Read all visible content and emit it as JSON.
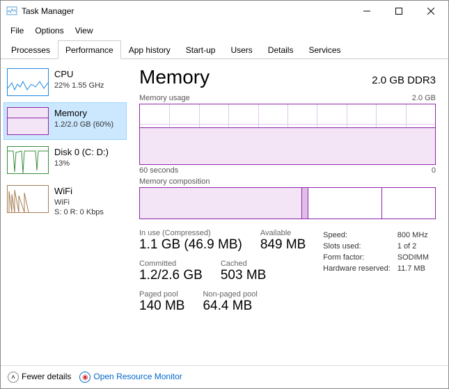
{
  "window": {
    "title": "Task Manager"
  },
  "menu": [
    "File",
    "Options",
    "View"
  ],
  "tabs": [
    "Processes",
    "Performance",
    "App history",
    "Start-up",
    "Users",
    "Details",
    "Services"
  ],
  "active_tab": 1,
  "sidebar": {
    "items": [
      {
        "name": "CPU",
        "sub": "22% 1.55 GHz"
      },
      {
        "name": "Memory",
        "sub": "1.2/2.0 GB (60%)"
      },
      {
        "name": "Disk 0 (C: D:)",
        "sub": "13%"
      },
      {
        "name": "WiFi",
        "sub": "WiFi",
        "sub2": "S: 0 R: 0 Kbps"
      }
    ],
    "selected": 1
  },
  "main": {
    "heading": "Memory",
    "heading_right": "2.0 GB DDR3",
    "usage_label": "Memory usage",
    "usage_max": "2.0 GB",
    "axis_left": "60 seconds",
    "axis_right": "0",
    "composition_label": "Memory composition",
    "stats": {
      "in_use_lbl": "In use (Compressed)",
      "in_use": "1.1 GB (46.9 MB)",
      "available_lbl": "Available",
      "available": "849 MB",
      "committed_lbl": "Committed",
      "committed": "1.2/2.6 GB",
      "cached_lbl": "Cached",
      "cached": "503 MB",
      "paged_lbl": "Paged pool",
      "paged": "140 MB",
      "nonpaged_lbl": "Non-paged pool",
      "nonpaged": "64.4 MB"
    },
    "specs": {
      "speed_lbl": "Speed:",
      "speed": "800 MHz",
      "slots_lbl": "Slots used:",
      "slots": "1 of 2",
      "form_lbl": "Form factor:",
      "form": "SODIMM",
      "hw_lbl": "Hardware reserved:",
      "hw": "11.7 MB"
    }
  },
  "footer": {
    "fewer": "Fewer details",
    "orm": "Open Resource Monitor"
  },
  "chart_data": {
    "type": "line",
    "title": "Memory usage",
    "ylabel": "GB",
    "ylim": [
      0,
      2.0
    ],
    "xlabel": "seconds",
    "xlim": [
      60,
      0
    ],
    "series": [
      {
        "name": "Memory",
        "values": [
          1.18,
          1.18,
          1.18,
          1.18,
          1.18,
          1.18,
          1.18,
          1.2,
          1.2,
          1.22,
          1.22,
          1.22,
          1.22
        ]
      }
    ],
    "composition": {
      "in_use_frac": 0.55,
      "modified_frac": 0.02,
      "standby_frac": 0.25,
      "free_frac": 0.18
    }
  }
}
